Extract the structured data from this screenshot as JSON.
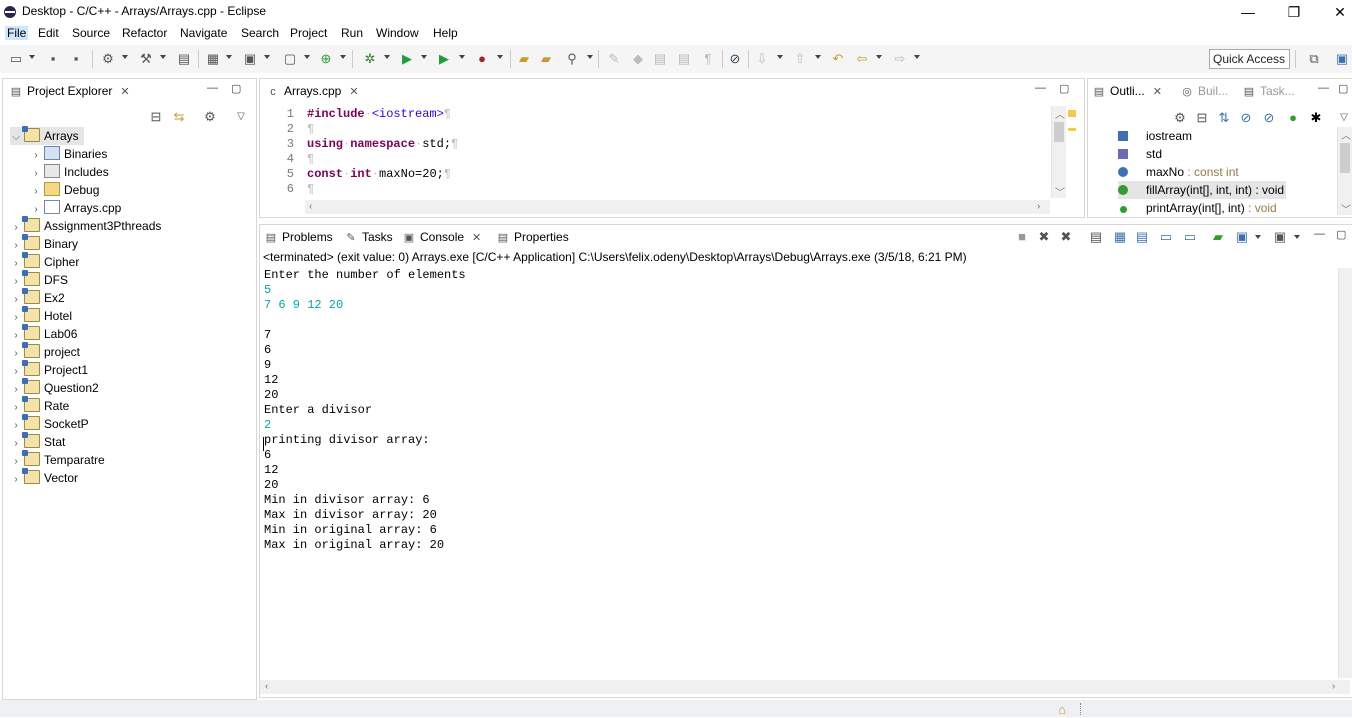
{
  "window": {
    "title": "Desktop - C/C++ - Arrays/Arrays.cpp - Eclipse",
    "minimize": "—",
    "restore": "❐",
    "close": "✕"
  },
  "menu": [
    "File",
    "Edit",
    "Source",
    "Refactor",
    "Navigate",
    "Search",
    "Project",
    "Run",
    "Window",
    "Help"
  ],
  "toolbar": {
    "quick_access": "Quick Access"
  },
  "project_explorer": {
    "title": "Project Explorer",
    "root": "Arrays",
    "children": [
      "Binaries",
      "Includes",
      "Debug",
      "Arrays.cpp"
    ],
    "projects": [
      "Assignment3Pthreads",
      "Binary",
      "Cipher",
      "DFS",
      "Ex2",
      "Hotel",
      "Lab06",
      "project",
      "Project1",
      "Question2",
      "Rate",
      "SocketP",
      "Stat",
      "Temparatre",
      "Vector"
    ]
  },
  "editor": {
    "tab": "Arrays.cpp",
    "line_numbers": [
      "1",
      "2",
      "3",
      "4",
      "5",
      "6"
    ],
    "lines": {
      "l1_kw": "#include",
      "l1_inc": "<iostream>",
      "l3_kw1": "using",
      "l3_kw2": "namespace",
      "l3_rest": "std;",
      "l5_kw1": "const",
      "l5_kw2": "int",
      "l5_rest": "maxNo=20;"
    },
    "pilcrow": "¶",
    "dot": "·"
  },
  "outline": {
    "tabs": [
      "Outli...",
      "Buil...",
      "Task..."
    ],
    "items": [
      {
        "name": "iostream",
        "type": ""
      },
      {
        "name": "std",
        "type": ""
      },
      {
        "name": "maxNo",
        "type": " : const int"
      },
      {
        "name": "fillArray(int[], int, int) : void",
        "type": ""
      },
      {
        "name": "printArray(int[], int)",
        "type": " : void"
      }
    ]
  },
  "console_view": {
    "tabs": [
      "Problems",
      "Tasks",
      "Console",
      "Properties"
    ],
    "status": "<terminated> (exit value: 0) Arrays.exe [C/C++ Application] C:\\Users\\felix.odeny\\Desktop\\Arrays\\Debug\\Arrays.exe (3/5/18, 6:21 PM)",
    "lines": [
      {
        "text": "Enter the number of elements",
        "input": false
      },
      {
        "text": "5",
        "input": true
      },
      {
        "text": "7 6 9 12 20",
        "input": true
      },
      {
        "text": "",
        "input": false
      },
      {
        "text": "7",
        "input": false
      },
      {
        "text": "6",
        "input": false
      },
      {
        "text": "9",
        "input": false
      },
      {
        "text": "12",
        "input": false
      },
      {
        "text": "20",
        "input": false
      },
      {
        "text": "Enter a divisor",
        "input": false
      },
      {
        "text": "2",
        "input": true
      },
      {
        "text": "printing divisor array:",
        "input": false
      },
      {
        "text": "6",
        "input": false
      },
      {
        "text": "12",
        "input": false
      },
      {
        "text": "20",
        "input": false
      },
      {
        "text": "Min in divisor array: 6",
        "input": false
      },
      {
        "text": "Max in divisor array: 20",
        "input": false
      },
      {
        "text": "Min in original array: 6",
        "input": false
      },
      {
        "text": "Max in original array: 20",
        "input": false
      }
    ]
  },
  "colors": {
    "keyword": "#7f0055",
    "include": "#2a00ff",
    "console_input": "#00a8a8",
    "outline_type": "#957d47"
  }
}
